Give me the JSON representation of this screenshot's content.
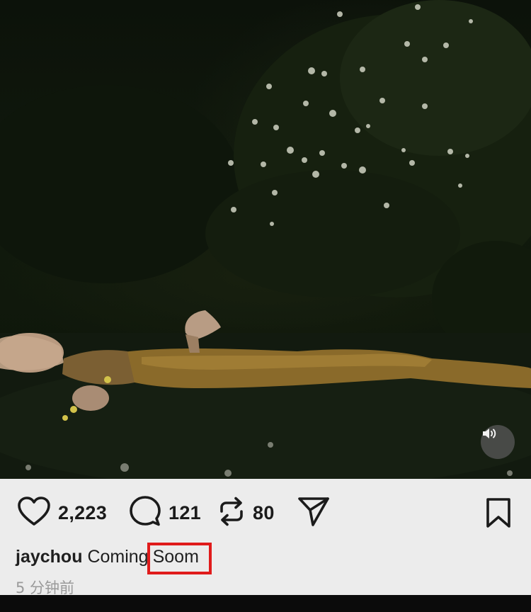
{
  "post": {
    "image_alt": "video-still-floating-figure",
    "actions": {
      "likes": "2,223",
      "comments": "121",
      "reposts": "80"
    },
    "caption": {
      "username": "jaychou",
      "text": "Coming",
      "highlight": "Soom"
    },
    "timestamp": "5 分钟前"
  },
  "icons": {
    "like": "heart-icon",
    "comment": "speech-bubble-icon",
    "repost": "repost-arrows-icon",
    "share": "send-paper-plane-icon",
    "bookmark": "bookmark-icon",
    "volume": "speaker-icon"
  },
  "colors": {
    "panel_bg": "#ececec",
    "highlight_box": "#e01b1b",
    "timestamp": "#9a9a9a"
  }
}
